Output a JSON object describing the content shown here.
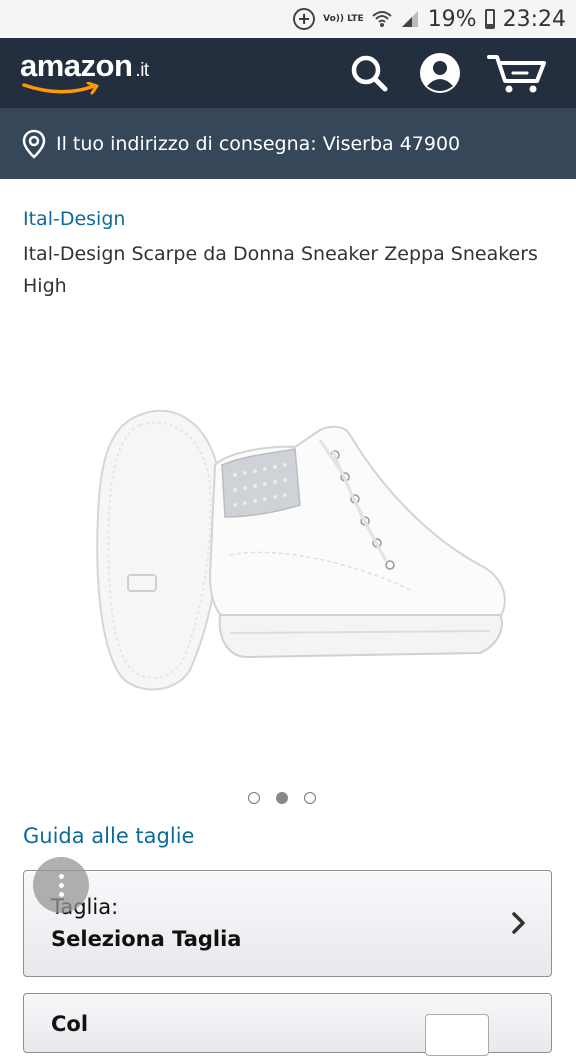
{
  "status_bar": {
    "lte": "Vo)) LTE",
    "battery": "19%",
    "time": "23:24"
  },
  "header": {
    "logo": "amazon",
    "logo_tld": ".it",
    "colors": {
      "bg": "#232f3e",
      "smile": "#ff9900"
    }
  },
  "delivery": {
    "text": "Il tuo indirizzo di consegna: Viserba 47900"
  },
  "product": {
    "brand": "Ital-Design",
    "title": "Ital-Design Scarpe da Donna Sneaker Zeppa Sneakers High",
    "image_carousel": {
      "count": 3,
      "active_index": 1
    }
  },
  "size_guide": "Guida alle taglie",
  "size_select": {
    "label": "Taglia:",
    "value": "Seleziona Taglia"
  },
  "next_box": {
    "text": "Col"
  }
}
